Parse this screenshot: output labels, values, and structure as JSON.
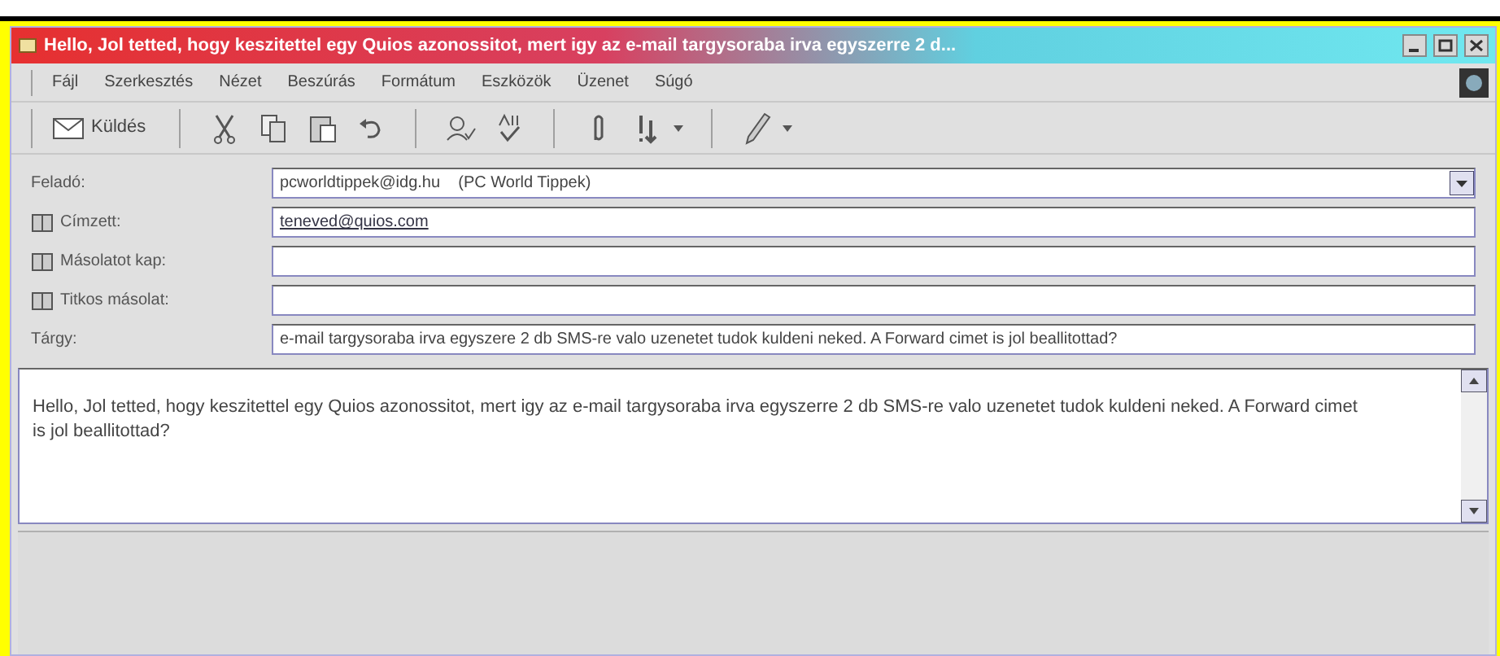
{
  "window": {
    "title": "Hello, Jol tetted, hogy keszitettel egy Quios azonossitot, mert igy az e-mail targysoraba irva egyszerre 2 d..."
  },
  "menu": [
    "Fájl",
    "Szerkesztés",
    "Nézet",
    "Beszúrás",
    "Formátum",
    "Eszközök",
    "Üzenet",
    "Súgó"
  ],
  "toolbar": [
    {
      "kind": "send",
      "label": "Küldés"
    },
    {
      "kind": "sep"
    },
    {
      "kind": "cut"
    },
    {
      "kind": "copy"
    },
    {
      "kind": "paste"
    },
    {
      "kind": "undo"
    },
    {
      "kind": "sep"
    },
    {
      "kind": "check"
    },
    {
      "kind": "spell"
    },
    {
      "kind": "sep"
    },
    {
      "kind": "attach"
    },
    {
      "kind": "priority"
    },
    {
      "kind": "sep"
    },
    {
      "kind": "sign"
    }
  ],
  "fields": [
    {
      "kind": "from",
      "label": "Feladó:",
      "value": "pcworldtippek@idg.hu    (PC World Tippek)"
    },
    {
      "kind": "address",
      "label": "Címzett:",
      "value": "teneved@quios.com"
    },
    {
      "kind": "address",
      "label": "Másolatot kap:"
    },
    {
      "kind": "address",
      "label": "Titkos másolat:"
    },
    {
      "kind": "subject",
      "label": "Tárgy:",
      "value": "e-mail targysoraba irva egyszere 2 db SMS-re valo uzenetet tudok kuldeni neked. A Forward cimet is jol beallitottad?"
    }
  ],
  "body": "Hello, Jol tetted, hogy keszitettel egy Quios azonossitot, mert igy az e-mail targysoraba irva egyszerre 2 db SMS-re valo uzenetet tudok kuldeni neked. A Forward cimet is jol beallitottad?"
}
